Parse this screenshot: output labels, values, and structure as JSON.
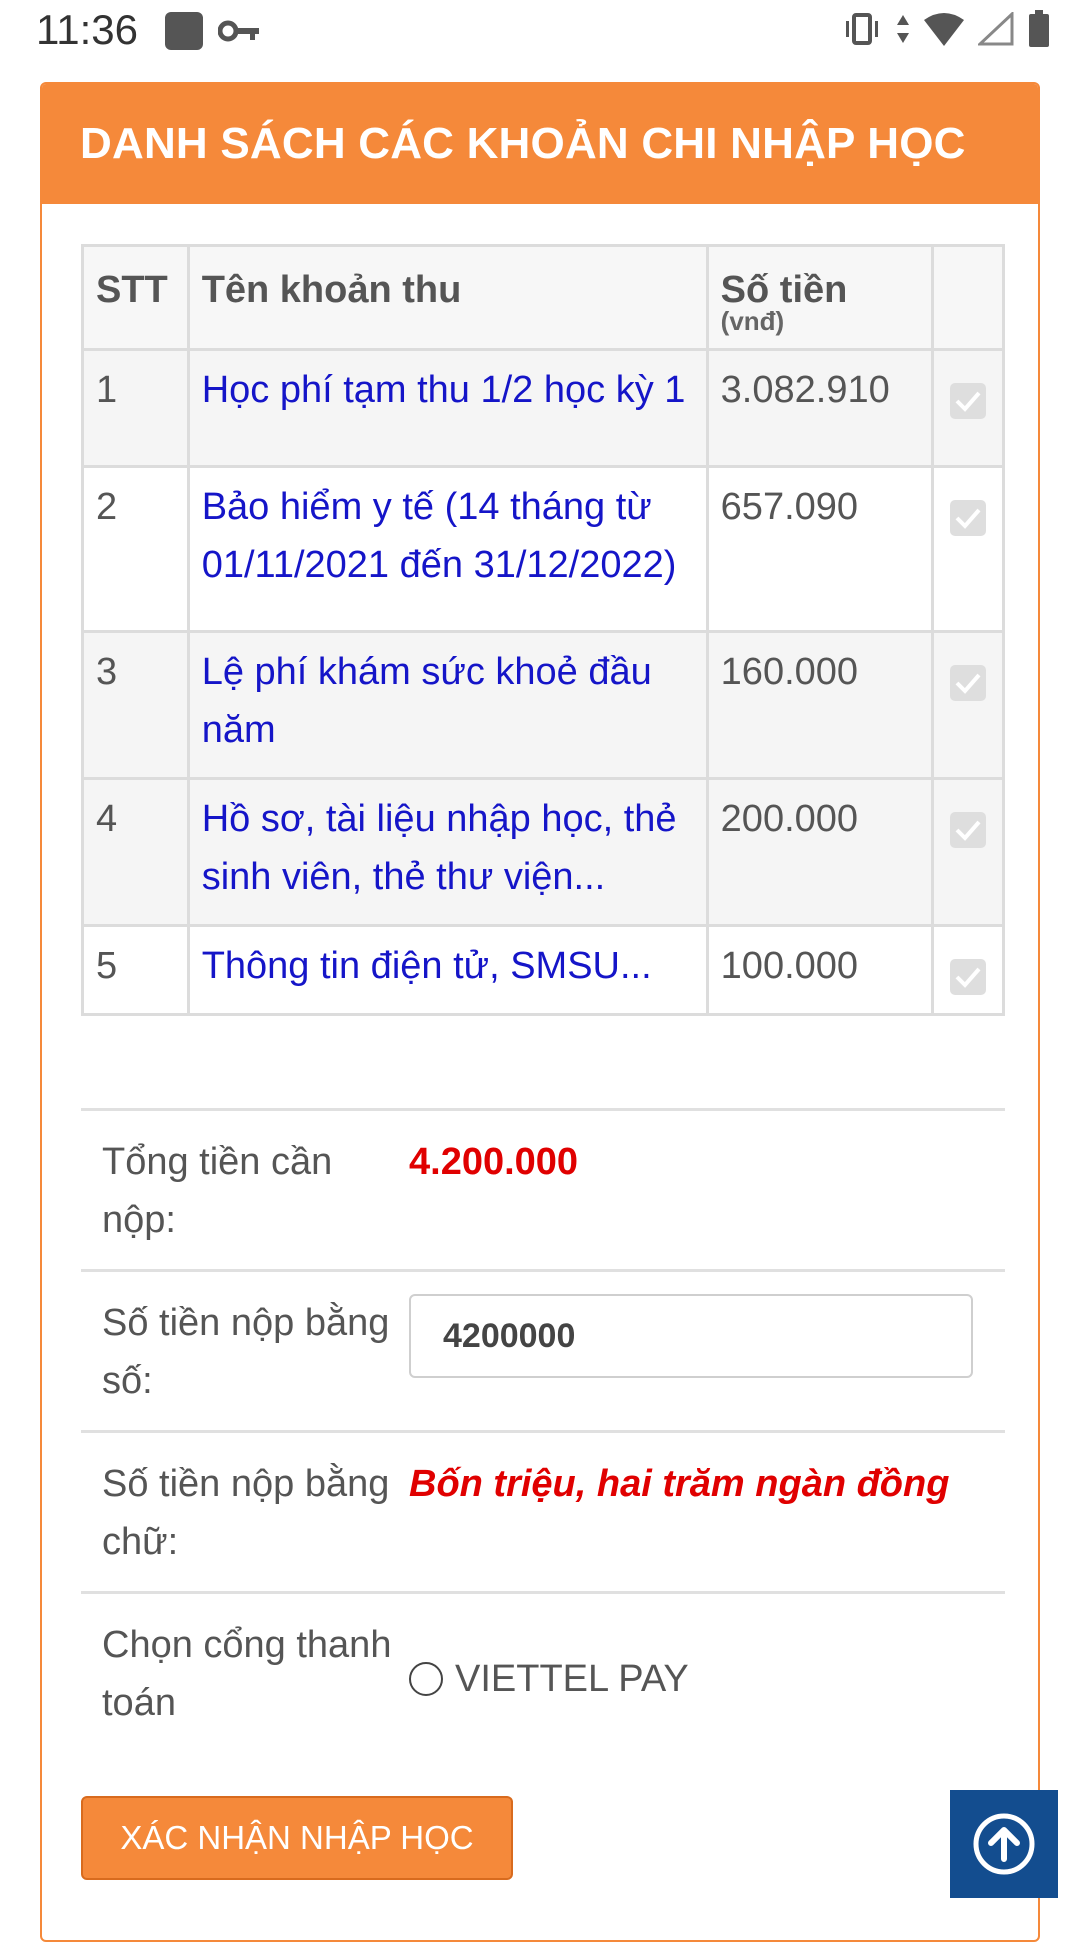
{
  "status_bar": {
    "time": "11:36",
    "icons": [
      "app-square-icon",
      "vpn-key-icon",
      "vibrate-icon",
      "data-arrows-icon",
      "wifi-icon",
      "signal-icon",
      "battery-icon"
    ]
  },
  "card": {
    "title": "DANH SÁCH CÁC KHOẢN CHI NHẬP HỌC",
    "accent_color": "#f5893a"
  },
  "fee_table": {
    "headers": {
      "stt": "STT",
      "name": "Tên khoản thu",
      "amount": "Số tiền",
      "amount_unit": "(vnđ)"
    },
    "rows": [
      {
        "stt": "1",
        "name": "Học phí tạm thu 1/2 học kỳ 1",
        "amount": "3.082.910",
        "checked": true
      },
      {
        "stt": "2",
        "name": "Bảo hiểm y tế (14 tháng từ 01/11/2021 đến 31/12/2022)",
        "amount": "657.090",
        "checked": true
      },
      {
        "stt": "3",
        "name": "Lệ phí khám sức khoẻ đầu năm",
        "amount": "160.000",
        "checked": true
      },
      {
        "stt": "4",
        "name": "Hồ sơ, tài liệu nhập học, thẻ sinh viên, thẻ thư viện...",
        "amount": "200.000",
        "checked": true
      },
      {
        "stt": "5",
        "name": "Thông tin điện tử, SMSU...",
        "amount": "100.000",
        "checked": true
      }
    ]
  },
  "summary": {
    "total_label": "Tổng tiền cần nộp:",
    "total_value": "4.200.000",
    "number_label": "Số tiền nộp bằng số:",
    "number_value": "4200000",
    "words_label": "Số tiền nộp bằng chữ:",
    "words_value": "Bốn triệu, hai trăm ngàn đồng",
    "gateway_label": "Chọn cổng thanh toán",
    "gateway_option": "VIETTEL PAY",
    "highlight_color": "#e00000"
  },
  "actions": {
    "confirm_label": "XÁC NHẬN NHẬP HỌC"
  }
}
